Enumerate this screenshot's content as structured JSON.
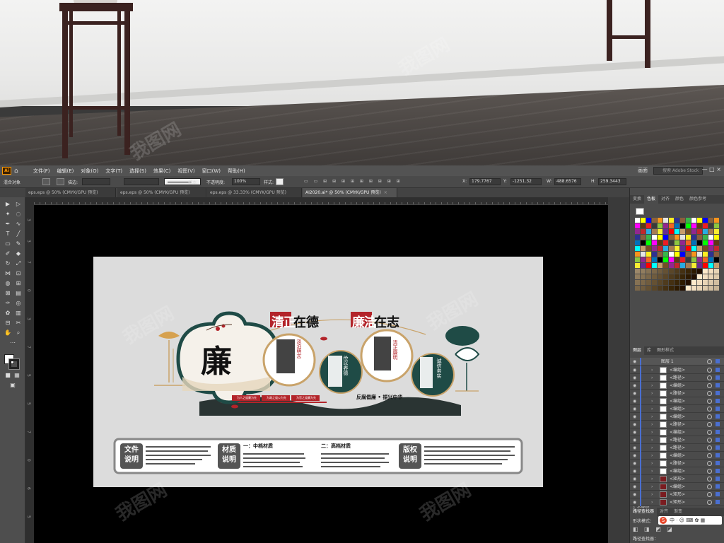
{
  "menubar": {
    "items": [
      "文件(F)",
      "编辑(E)",
      "对象(O)",
      "文字(T)",
      "选择(S)",
      "效果(C)",
      "视图(V)",
      "窗口(W)",
      "帮助(H)"
    ],
    "workspace": "画面",
    "search_placeholder": "搜索 Adobe Stock",
    "win_controls": "—  □  ×"
  },
  "control_bar": {
    "selection": "混合对象",
    "stroke_label": "描边:",
    "stroke_value": "基本",
    "opacity_label": "不透明度:",
    "opacity_value": "100%",
    "style_label": "样式:",
    "x_value": "179.7767",
    "y_value": "-1251.32",
    "w_value": "488.6576",
    "h_value": "259.3443"
  },
  "doc_tabs": [
    {
      "label": "eps.eps @ 50% (CMYK/GPU 预览)",
      "active": false
    },
    {
      "label": "eps.eps @ 50% (CMYK/GPU 预览)",
      "active": false
    },
    {
      "label": "eps.eps @ 33.33% (CMYK/GPU 预览)",
      "active": false
    },
    {
      "label": "AI2020.ai* @ 50% (CMYK/GPU 预览)",
      "active": true
    }
  ],
  "ruler_v": [
    "3",
    "3",
    "7",
    "0",
    "3",
    "7",
    "5",
    "5",
    "7",
    "0",
    "6",
    "5",
    "0",
    "0",
    "0",
    "6",
    "5",
    "0",
    "0",
    "7",
    "0",
    "0",
    "0",
    "7"
  ],
  "artwork": {
    "big_char": "廉",
    "headline_a1": "清正",
    "headline_a2": "在德",
    "headline_b1": "廉洁",
    "headline_b2": "在志",
    "vertical_label_1": "淡泊明志",
    "vertical_label_2": "俭以养德",
    "vertical_label_3": "清正廉明",
    "vertical_label_4": "诚信务实",
    "slogan": "反腐倡廉 • 振兴中华",
    "red_tags": [
      "为人之道廉为先",
      "为政之道公为先",
      "为官之道廉为先"
    ],
    "info_blocks": [
      {
        "title_line1": "文件",
        "title_line2": "说明"
      },
      {
        "title_line1": "材质",
        "title_line2": "说明"
      },
      {
        "title_line1": "版权",
        "title_line2": "说明"
      }
    ],
    "material_1": "一：中档材质",
    "material_2": "二：高档材质"
  },
  "right_panel": {
    "tabs_top": [
      "变换",
      "色板",
      "对齐",
      "路径查找器",
      "颜色",
      "颜色参考"
    ],
    "tabs_layers": [
      "图层",
      "库",
      "图形样式"
    ],
    "layer_top": "图层 1",
    "layer_rows": [
      "<编组>",
      "<路径>",
      "<编组>",
      "<路径>",
      "<编组>",
      "<编组>",
      "<编组>",
      "<路径>",
      "<编组>",
      "<路径>",
      "<路径>",
      "<编组>",
      "<路径>",
      "<编组>",
      "<矩形>",
      "<编组>",
      "<矩形>",
      "<矩形>"
    ],
    "layer_count": "1 个图层",
    "pathfinder_tabs": [
      "路径查找器",
      "对齐",
      "渐变"
    ],
    "shape_mode_label": "形状模式：",
    "pathfinder_label": "路径查找器："
  },
  "watermark": "我图网",
  "colors": {
    "accent_red": "#b3242a",
    "teal": "#1f4b46",
    "gold": "#c9a36a",
    "ui_dark": "#535353"
  }
}
